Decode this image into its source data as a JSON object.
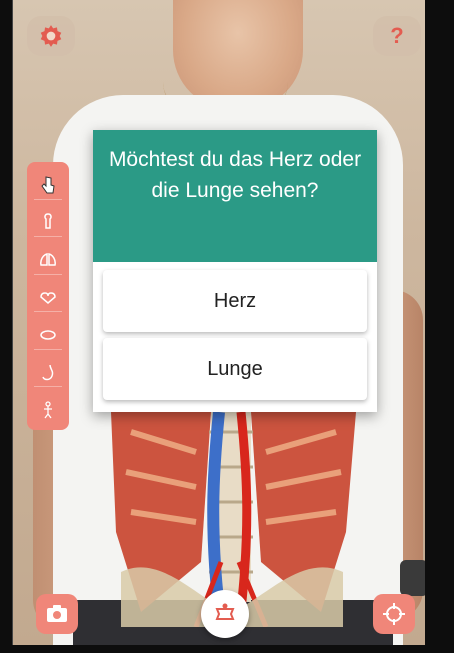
{
  "dialog": {
    "question": "Möchtest du das Herz oder die Lunge sehen?",
    "options": [
      "Herz",
      "Lunge"
    ]
  },
  "icons": {
    "settings": "gear-icon",
    "help": "question-mark-icon",
    "camera": "camera-icon",
    "target": "crosshair-icon",
    "center": "body-scan-icon",
    "tools": [
      "hand-pointer-icon",
      "bone-icon",
      "lungs-icon",
      "heart-icon",
      "kidney-icon",
      "stomach-icon",
      "body-icon"
    ]
  },
  "colors": {
    "accent": "#f08679",
    "dialog_header": "#2b9a86"
  }
}
